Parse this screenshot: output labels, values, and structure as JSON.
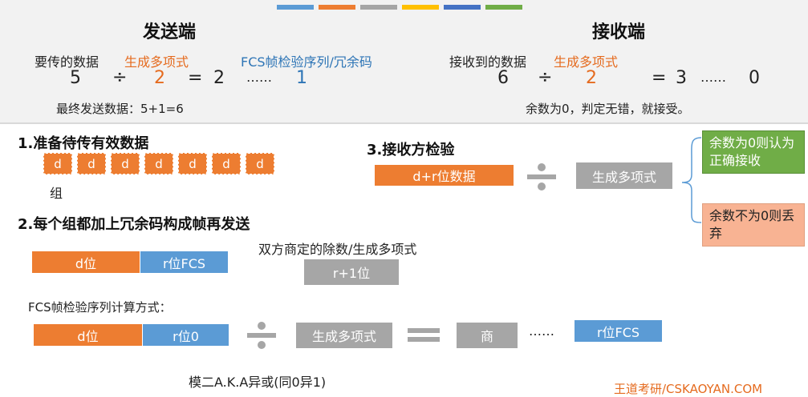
{
  "top_strip_colors": [
    "#5b9bd5",
    "#ed7d31",
    "#a5a5a5",
    "#ffc000",
    "#4472c4",
    "#70ad47"
  ],
  "sender": {
    "title": "发送端",
    "label_data": "要传的数据",
    "label_poly": "生成多项式",
    "label_fcs": "FCS帧检验序列/冗余码",
    "eq_data": "5",
    "eq_div": "÷",
    "eq_poly": "2",
    "eq_equals": "=",
    "eq_quot": "2",
    "eq_dots": "……",
    "eq_rem": "1",
    "final": "最终发送数据：5+1=6"
  },
  "receiver": {
    "title": "接收端",
    "label_data": "接收到的数据",
    "label_poly": "生成多项式",
    "eq_data": "6",
    "eq_div": "÷",
    "eq_poly": "2",
    "eq_equals": "=",
    "eq_quot": "3",
    "eq_dots": "……",
    "eq_rem": "0",
    "conclusion": "余数为0，判定无错，就接受。"
  },
  "step1": {
    "heading": "1.准备待传有效数据",
    "cells": [
      "d",
      "d",
      "d",
      "d",
      "d",
      "d",
      "d"
    ],
    "group_label": "组"
  },
  "step2": {
    "heading": "2.每个组都加上冗余码构成帧再发送",
    "d_box": "d位",
    "r_box": "r位FCS",
    "divisor_label": "双方商定的除数/生成多项式",
    "r1_box": "r+1位"
  },
  "step3": {
    "heading": "3.接收方检验",
    "dr_box": "d+r位数据",
    "poly_box": "生成多项式",
    "ok_box": "余数为0则认为正确接收",
    "bad_box": "余数不为0则丢弃"
  },
  "fcs_calc": {
    "heading": "FCS帧检验序列计算方式：",
    "d_box": "d位",
    "r0_box": "r位0",
    "poly_box": "生成多项式",
    "quot_box": "商",
    "dots": "……",
    "rfcs_box": "r位FCS",
    "mod2_note": "模二A.K.A异或(同0异1)"
  },
  "watermark": "王道考研/CSKAOYAN.COM"
}
